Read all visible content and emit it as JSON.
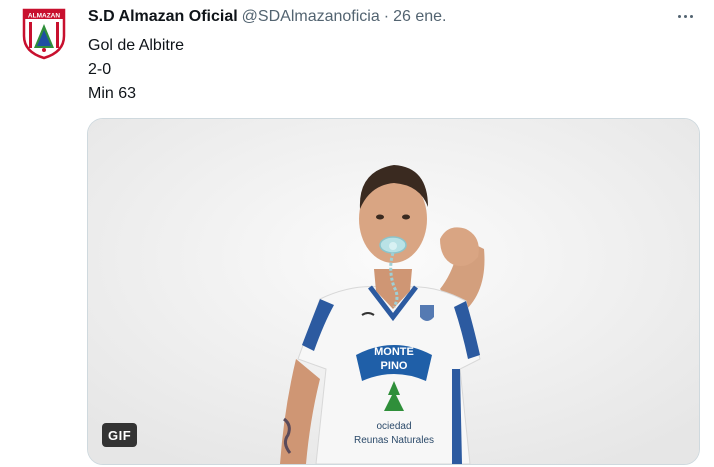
{
  "tweet": {
    "author_name": "S.D Almazan Oficial",
    "handle": "@SDAlmazanoficia",
    "separator": "·",
    "date": "26 ene.",
    "lines": [
      "Gol de Albitre",
      "2-0",
      "Min 63"
    ],
    "more_icon": "more-horizontal-icon"
  },
  "avatar": {
    "badge_text": "ALMAZAN",
    "colors": {
      "red": "#c8102e",
      "green": "#2f8f3a",
      "blue": "#1f4fa3"
    }
  },
  "media": {
    "type": "gif",
    "badge_label": "GIF",
    "shirt_text_1": "MONTE",
    "shirt_text_2": "PINO",
    "shirt_text_3": "ociedad",
    "shirt_text_4": "Reunas Naturales",
    "colors": {
      "shirt": "#f7f7f7",
      "trim": "#2c5aa0",
      "skin": "#d9a583",
      "hair": "#3a2a20"
    }
  },
  "theme": {
    "text": "#0f1419",
    "muted": "#536471",
    "border": "#cfd9de"
  }
}
